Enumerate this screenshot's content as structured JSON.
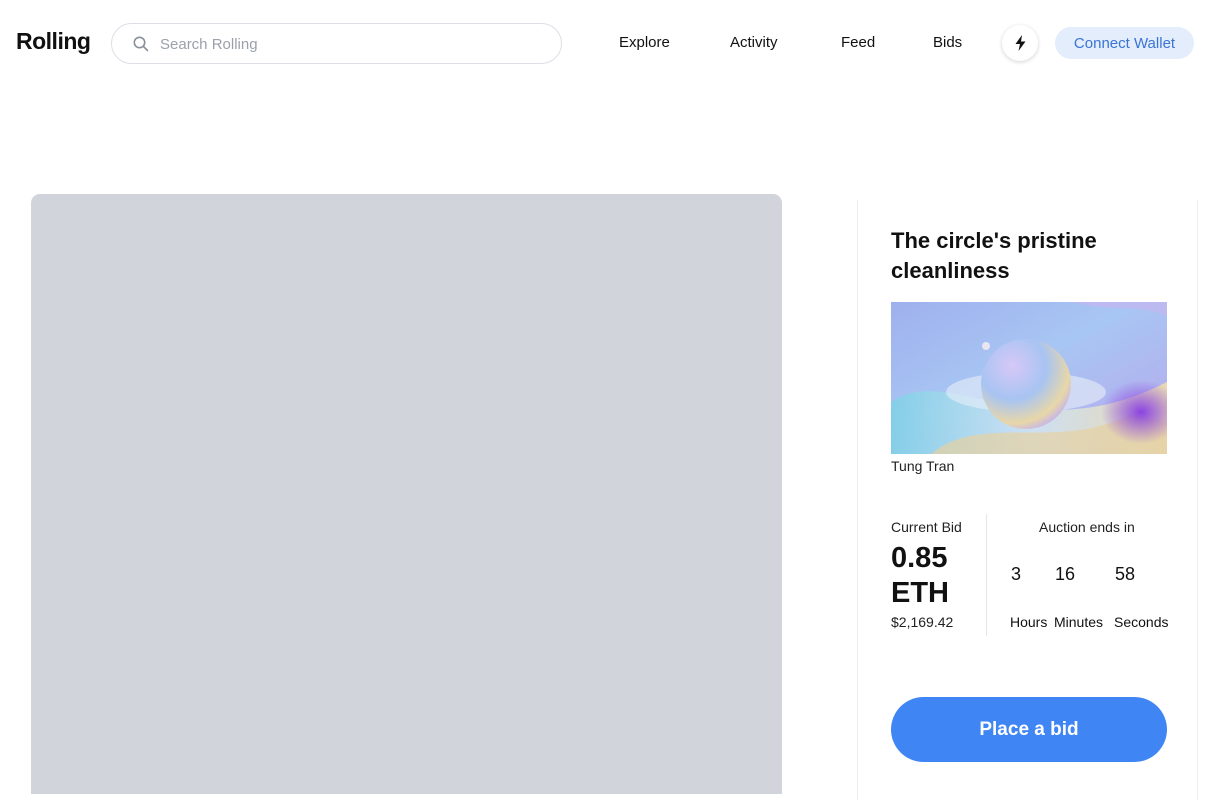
{
  "header": {
    "logo": "Rolling",
    "search_placeholder": "Search Rolling",
    "search_value": "",
    "nav": [
      "Explore",
      "Activity",
      "Feed",
      "Bids"
    ],
    "bolt_icon": "lightning-bolt-icon",
    "connect_wallet": "Connect Wallet"
  },
  "artwork": {
    "title": "The circle's pristine cleanliness",
    "artist": "Tung Tran",
    "thumbnail_icon": "abstract-sphere-artwork"
  },
  "bid": {
    "current_label": "Current Bid",
    "amount": "0.85 ETH",
    "usd": "$2,169.42"
  },
  "auction": {
    "label": "Auction ends in",
    "hours": "3",
    "minutes": "16",
    "seconds": "58",
    "hours_label": "Hours",
    "minutes_label": "Minutes",
    "seconds_label": "Seconds"
  },
  "actions": {
    "place_bid": "Place a bid"
  },
  "colors": {
    "accent": "#3f86f4",
    "wallet_bg": "#e3edfb",
    "wallet_text": "#3a74d6",
    "placeholder_image": "#d1d4da"
  }
}
